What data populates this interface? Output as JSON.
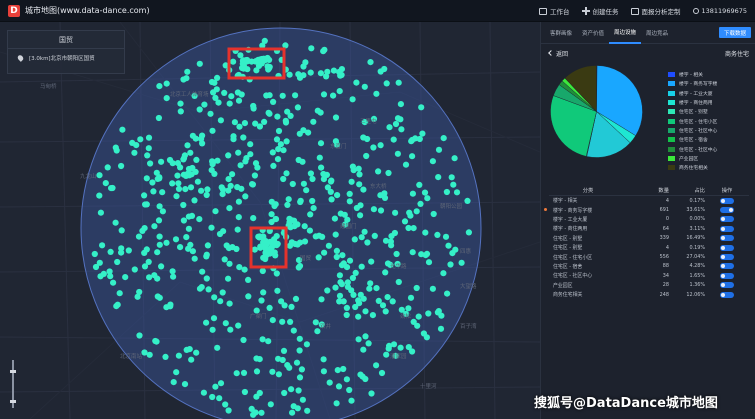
{
  "header": {
    "logo_letter": "D",
    "title": "城市地图(www.data-dance.com)",
    "items": [
      {
        "icon": "workbench-icon",
        "label": "工作台"
      },
      {
        "icon": "plus-icon",
        "label": "创建任务"
      },
      {
        "icon": "report-icon",
        "label": "面报分析定制"
      },
      {
        "icon": "user-icon",
        "label": "13811969675"
      }
    ]
  },
  "map": {
    "panel_title": "国贸",
    "panel_item": "[3.0km]北京市朝阳区国贸",
    "labels": [
      "马甸桥",
      "北京工人体育场",
      "三里屯",
      "东直门",
      "建国门",
      "国贸",
      "双井",
      "劲松",
      "潘家园",
      "十里河",
      "北京南站",
      "广渠门",
      "光华路",
      "东大桥",
      "朝阳公园",
      "四惠",
      "大望路",
      "九龙山",
      "百子湾"
    ]
  },
  "panel": {
    "tabs": [
      "客群画像",
      "资产价值",
      "周边设施",
      "周边竞品"
    ],
    "active_tab": 2,
    "download_label": "下载数据",
    "back_label": "返回",
    "section_title": "商务住宅",
    "legend": [
      {
        "label": "楼宇 - 相关",
        "color": "#1f4dff"
      },
      {
        "label": "楼宇 - 商务写字楼",
        "color": "#19a7ff"
      },
      {
        "label": "楼宇 - 工业大厦",
        "color": "#18d0e8"
      },
      {
        "label": "楼宇 - 商住两用",
        "color": "#1ee6d2"
      },
      {
        "label": "住宅区 - 别墅",
        "color": "#2ee8b6"
      },
      {
        "label": "住宅区 - 住宅小区",
        "color": "#10c97a"
      },
      {
        "label": "住宅区 - 社区中心",
        "color": "#18a86b"
      },
      {
        "label": "住宅区 - 宿舍",
        "color": "#13c24a"
      },
      {
        "label": "住宅区 - 社区中心",
        "color": "#1f8f3a"
      },
      {
        "label": "产业园区",
        "color": "#3be83b"
      },
      {
        "label": "商务住宅相关",
        "color": "#3a3a12"
      }
    ],
    "table_headers": [
      "分类",
      "数量",
      "占比",
      "操作"
    ],
    "table_rows": [
      {
        "name": "楼宇 - 相关",
        "count": "4",
        "pct": "0.17%",
        "on": false,
        "highlight": false
      },
      {
        "name": "楼宇 - 商务写字楼",
        "count": "691",
        "pct": "33.61%",
        "on": true,
        "highlight": true
      },
      {
        "name": "楼宇 - 工业大厦",
        "count": "0",
        "pct": "0.00%",
        "on": false,
        "highlight": false
      },
      {
        "name": "楼宇 - 商住两用",
        "count": "64",
        "pct": "3.11%",
        "on": false,
        "highlight": false
      },
      {
        "name": "住宅区 - 别墅",
        "count": "339",
        "pct": "16.49%",
        "on": false,
        "highlight": false
      },
      {
        "name": "住宅区 - 别墅",
        "count": "4",
        "pct": "0.19%",
        "on": false,
        "highlight": false
      },
      {
        "name": "住宅区 - 住宅小区",
        "count": "556",
        "pct": "27.04%",
        "on": false,
        "highlight": false
      },
      {
        "name": "住宅区 - 宿舍",
        "count": "88",
        "pct": "4.28%",
        "on": false,
        "highlight": false
      },
      {
        "name": "住宅区 - 社区中心",
        "count": "34",
        "pct": "1.65%",
        "on": false,
        "highlight": false
      },
      {
        "name": "产业园区",
        "count": "28",
        "pct": "1.36%",
        "on": false,
        "highlight": false
      },
      {
        "name": "商务住宅相关",
        "count": "248",
        "pct": "12.06%",
        "on": false,
        "highlight": false
      }
    ]
  },
  "chart_data": {
    "type": "pie",
    "categories": [
      "楼宇 - 相关",
      "楼宇 - 商务写字楼",
      "楼宇 - 工业大厦",
      "楼宇 - 商住两用",
      "住宅区 - 别墅",
      "住宅区 - 别墅",
      "住宅区 - 住宅小区",
      "住宅区 - 宿舍",
      "住宅区 - 社区中心",
      "产业园区",
      "商务住宅相关"
    ],
    "values": [
      4,
      691,
      0,
      64,
      339,
      4,
      556,
      88,
      34,
      28,
      248
    ],
    "colors": [
      "#1f4dff",
      "#19a7ff",
      "#18d0e8",
      "#1ee6d2",
      "#22c9d6",
      "#2ee8b6",
      "#10c97a",
      "#18a86b",
      "#1f8f3a",
      "#3be83b",
      "#3a3a12"
    ]
  },
  "watermark": "搜狐号@DataDance城市地图"
}
